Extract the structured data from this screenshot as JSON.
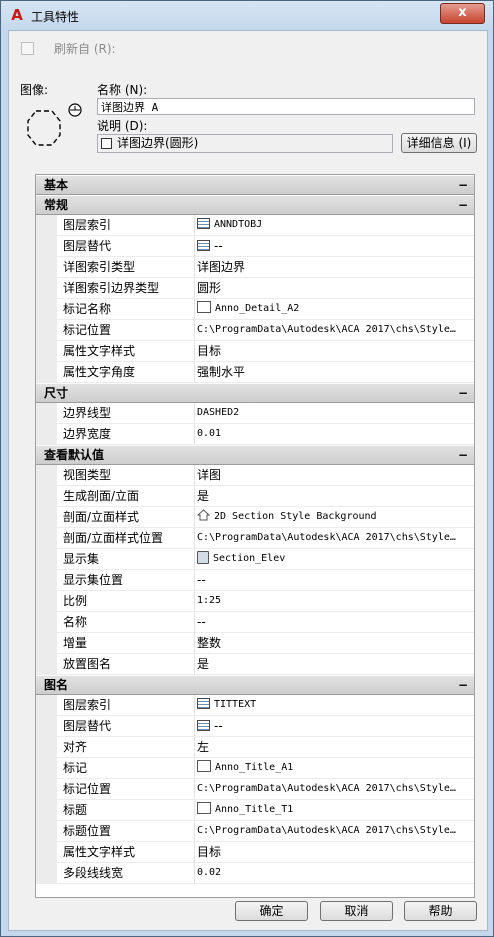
{
  "window": {
    "title": "工具特性",
    "close_glyph": "x"
  },
  "refresh": {
    "label": "刷新自 (R):"
  },
  "image": {
    "label": "图像:"
  },
  "name": {
    "label": "名称 (N):",
    "value": "详图边界 A"
  },
  "description": {
    "label": "说明 (D):",
    "value": "详图边界(圆形)"
  },
  "details_button": {
    "label": "详细信息 (I)"
  },
  "colors": {
    "category_bg": "#d4d4d4",
    "client_bg": "#f0f0f0",
    "frame": "#c4d7ec",
    "close": "#c7442f"
  },
  "sections": [
    {
      "title": "基本",
      "rows": []
    },
    {
      "title": "常规",
      "rows": [
        {
          "name": "图层索引",
          "value": "ANNDTOBJ",
          "icon": "table-icon",
          "mono": true
        },
        {
          "name": "图层替代",
          "value": "--",
          "icon": "table-icon"
        },
        {
          "name": "详图索引类型",
          "value": "详图边界"
        },
        {
          "name": "详图索引边界类型",
          "value": "圆形"
        },
        {
          "name": "标记名称",
          "value": "Anno_Detail_A2",
          "icon": "tag-icon",
          "mono": true
        },
        {
          "name": "标记位置",
          "value": "C:\\ProgramData\\Autodesk\\ACA  2017\\chs\\Style…",
          "mono": true
        },
        {
          "name": "属性文字样式",
          "value": "目标"
        },
        {
          "name": "属性文字角度",
          "value": "强制水平"
        }
      ]
    },
    {
      "title": "尺寸",
      "rows": [
        {
          "name": "边界线型",
          "value": "DASHED2",
          "mono": true
        },
        {
          "name": "边界宽度",
          "value": "0.01",
          "mono": true
        }
      ]
    },
    {
      "title": "查看默认值",
      "rows": [
        {
          "name": "视图类型",
          "value": "详图"
        },
        {
          "name": "生成剖面/立面",
          "value": "是"
        },
        {
          "name": "剖面/立面样式",
          "value": "2D Section Style Background",
          "icon": "house-icon",
          "mono": true
        },
        {
          "name": "剖面/立面样式位置",
          "value": "C:\\ProgramData\\Autodesk\\ACA  2017\\chs\\Style…",
          "mono": true
        },
        {
          "name": "显示集",
          "value": "Section_Elev",
          "icon": "display-set-icon",
          "mono": true
        },
        {
          "name": "显示集位置",
          "value": "--"
        },
        {
          "name": "比例",
          "value": "1:25",
          "mono": true
        },
        {
          "name": "名称",
          "value": "--"
        },
        {
          "name": "增量",
          "value": "整数"
        },
        {
          "name": "放置图名",
          "value": "是"
        }
      ]
    },
    {
      "title": "图名",
      "rows": [
        {
          "name": "图层索引",
          "value": "TITTEXT",
          "icon": "table-icon",
          "mono": true
        },
        {
          "name": "图层替代",
          "value": "--",
          "icon": "table-icon"
        },
        {
          "name": "对齐",
          "value": "左"
        },
        {
          "name": "标记",
          "value": "Anno_Title_A1",
          "icon": "tag-icon",
          "mono": true
        },
        {
          "name": "标记位置",
          "value": "C:\\ProgramData\\Autodesk\\ACA  2017\\chs\\Style…",
          "mono": true
        },
        {
          "name": "标题",
          "value": "Anno_Title_T1",
          "icon": "tag-icon",
          "mono": true
        },
        {
          "name": "标题位置",
          "value": "C:\\ProgramData\\Autodesk\\ACA  2017\\chs\\Style…",
          "mono": true
        },
        {
          "name": "属性文字样式",
          "value": "目标"
        },
        {
          "name": "多段线线宽",
          "value": "0.02",
          "mono": true
        }
      ]
    }
  ],
  "collapse_glyph": "−",
  "buttons": {
    "ok": "确定",
    "cancel": "取消",
    "help": "帮助"
  }
}
